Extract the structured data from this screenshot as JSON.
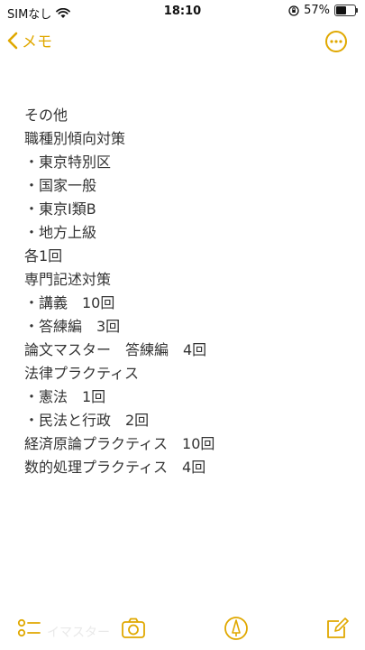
{
  "status_bar": {
    "carrier": "SIMなし",
    "time": "18:10",
    "battery_percent": "57%",
    "battery_level": 0.57
  },
  "nav": {
    "back_label": "メモ"
  },
  "note": {
    "lines": [
      "その他",
      "職種別傾向対策",
      "・東京特別区",
      "・国家一般",
      "・東京Ⅰ類B",
      "・地方上級",
      "各1回",
      "専門記述対策",
      "・講義　10回",
      "・答練編　3回",
      "論文マスター　答練編　4回",
      "法律プラクティス",
      "・憲法　1回",
      "・民法と行政　2回",
      "経済原論プラクティス　10回",
      "数的処理プラクティス　4回"
    ]
  },
  "toolbar": {
    "ghost_text": "イマスター",
    "icons": [
      "checklist-icon",
      "camera-icon",
      "markup-icon",
      "compose-icon"
    ]
  },
  "colors": {
    "accent": "#e0a800"
  }
}
